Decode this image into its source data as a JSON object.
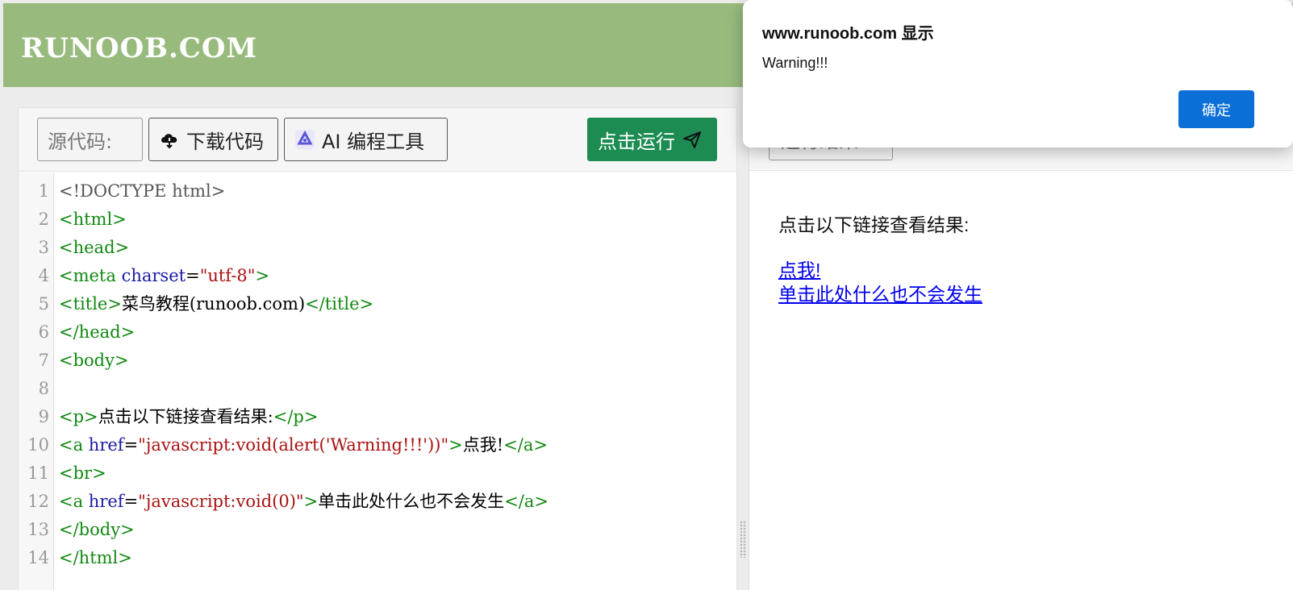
{
  "header": {
    "logo": "RUNOOB.COM"
  },
  "toolbar": {
    "source_label": "源代码:",
    "download_label": "下载代码",
    "ai_label": "AI 编程工具",
    "run_label": "点击运行",
    "download_icon": "cloud-download-icon",
    "ai_icon": "ai-logo-icon",
    "run_icon": "send-icon"
  },
  "code_lines": [
    {
      "n": "1",
      "parts": [
        {
          "t": "<!DOCTYPE html>",
          "c": "doc"
        }
      ]
    },
    {
      "n": "2",
      "parts": [
        {
          "t": "<html>",
          "c": "tag"
        }
      ]
    },
    {
      "n": "3",
      "parts": [
        {
          "t": "<head>",
          "c": "tag"
        }
      ]
    },
    {
      "n": "4",
      "parts": [
        {
          "t": "<meta ",
          "c": "tag"
        },
        {
          "t": "charset",
          "c": "att"
        },
        {
          "t": "=",
          "c": "plain"
        },
        {
          "t": "\"utf-8\"",
          "c": "str"
        },
        {
          "t": ">",
          "c": "tag"
        }
      ]
    },
    {
      "n": "5",
      "parts": [
        {
          "t": "<title>",
          "c": "tag"
        },
        {
          "t": "菜鸟教程(runoob.com)",
          "c": "plain"
        },
        {
          "t": "</title>",
          "c": "tag"
        }
      ]
    },
    {
      "n": "6",
      "parts": [
        {
          "t": "</head>",
          "c": "tag"
        }
      ]
    },
    {
      "n": "7",
      "parts": [
        {
          "t": "<body>",
          "c": "tag"
        }
      ]
    },
    {
      "n": "8",
      "parts": []
    },
    {
      "n": "9",
      "parts": [
        {
          "t": "<p>",
          "c": "tag"
        },
        {
          "t": "点击以下链接查看结果:",
          "c": "plain"
        },
        {
          "t": "</p>",
          "c": "tag"
        }
      ]
    },
    {
      "n": "10",
      "parts": [
        {
          "t": "<a ",
          "c": "tag"
        },
        {
          "t": "href",
          "c": "att"
        },
        {
          "t": "=",
          "c": "plain"
        },
        {
          "t": "\"javascript:void(alert('Warning!!!'))\"",
          "c": "str"
        },
        {
          "t": ">",
          "c": "tag"
        },
        {
          "t": "点我!",
          "c": "plain"
        },
        {
          "t": "</a>",
          "c": "tag"
        }
      ]
    },
    {
      "n": "11",
      "parts": [
        {
          "t": "<br>",
          "c": "tag"
        }
      ]
    },
    {
      "n": "12",
      "parts": [
        {
          "t": "<a ",
          "c": "tag"
        },
        {
          "t": "href",
          "c": "att"
        },
        {
          "t": "=",
          "c": "plain"
        },
        {
          "t": "\"javascript:void(0)\"",
          "c": "str"
        },
        {
          "t": ">",
          "c": "tag"
        },
        {
          "t": "单击此处什么也不会发生",
          "c": "plain"
        },
        {
          "t": "</a>",
          "c": "tag"
        }
      ]
    },
    {
      "n": "13",
      "parts": [
        {
          "t": "</body>",
          "c": "tag"
        }
      ]
    },
    {
      "n": "14",
      "parts": [
        {
          "t": "</html>",
          "c": "tag"
        }
      ]
    }
  ],
  "result": {
    "toolbar_label": "运行结果",
    "paragraph": "点击以下链接查看结果:",
    "link1": "点我!",
    "link2": "单击此处什么也不会发生"
  },
  "dialog": {
    "title": "www.runoob.com 显示",
    "message": "Warning!!!",
    "ok_label": "确定"
  },
  "colors": {
    "header": "#98bb7d",
    "run_button": "#1c8c53",
    "ok_button": "#0a6fd6"
  }
}
